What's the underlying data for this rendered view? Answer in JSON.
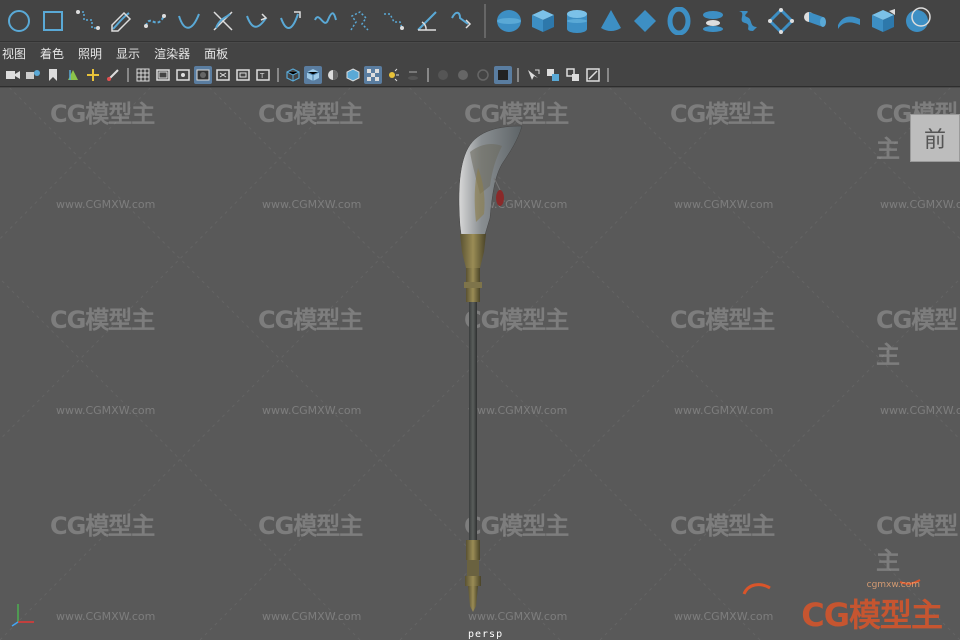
{
  "shelf": {
    "left_tools": [
      "circle-curve-icon",
      "square-curve-icon",
      "cv-curve-icon",
      "pencil-curve-icon",
      "ep-curve-icon",
      "bezier-curve-icon",
      "arc-curve-icon",
      "two-point-arc-icon",
      "three-point-arc-icon",
      "offset-curve-icon",
      "curve-fillet-icon",
      "rebuild-curve-icon",
      "cut-curve-icon",
      "attach-curve-icon"
    ],
    "right_tools": [
      "sphere-icon",
      "cube-icon",
      "cylinder-icon",
      "cone-icon",
      "plane-icon",
      "torus-icon",
      "revolve-icon",
      "loft-icon",
      "planar-icon",
      "extrude-icon",
      "birail-icon",
      "bevel-icon",
      "nurbs-sphere-icon"
    ]
  },
  "menu": [
    "视图",
    "着色",
    "照明",
    "显示",
    "渲染器",
    "面板"
  ],
  "viewport": {
    "view_cube_label": "前",
    "camera_label": "persp",
    "watermark_logo": "CG模型主",
    "watermark_url": "www.CGMXW.com",
    "big_logo_url": "cgmxw.com",
    "big_logo_text": "CG模型主"
  },
  "colors": {
    "viewport_bg": "#595959",
    "shelf_bg": "#444444",
    "shelf_icon": "#5aa9d6",
    "active_button": "#5a7da0"
  }
}
